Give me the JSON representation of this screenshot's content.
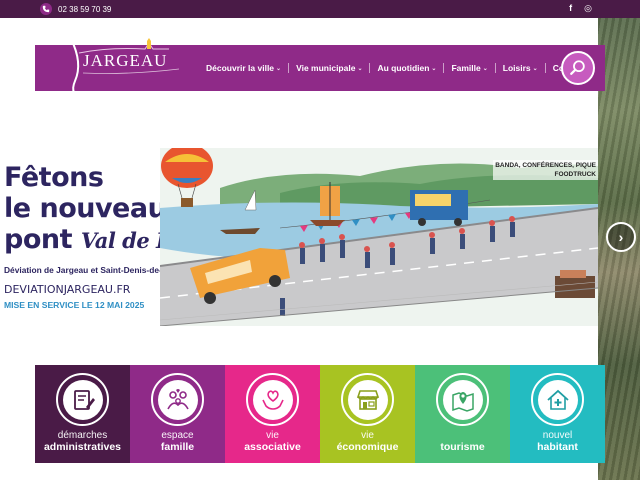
{
  "topbar": {
    "phone": "02 38 59 70 39",
    "social": [
      "f",
      "◎"
    ]
  },
  "header": {
    "logo_text": "JARGEAU",
    "nav": [
      {
        "label": "Découvrir la ville",
        "caret": "⌄"
      },
      {
        "label": "Vie municipale",
        "caret": "⌄"
      },
      {
        "label": "Au quotidien",
        "caret": "⌄"
      },
      {
        "label": "Famille",
        "caret": "⌄"
      },
      {
        "label": "Loisirs",
        "caret": "⌄"
      },
      {
        "label": "Contact",
        "caret": ""
      }
    ],
    "search_icon": "search-icon"
  },
  "hero": {
    "title_line1": "Fêtons",
    "title_line2": "le nouveau",
    "title_line3_a": "pont",
    "title_line3_b": "Val de Loire",
    "subtitle": "Déviation de Jargeau et Saint-Denis-de-l'Hôtel",
    "url": "DEVIATIONJARGEAU.FR",
    "date": "MISE EN SERVICE LE 12 MAI 2025",
    "banda_line1": "BANDA, CONFÉRENCES, PIQUE",
    "banda_line2": "FOODTRUCK"
  },
  "carousel": {
    "next": "›"
  },
  "tiles": [
    {
      "line1": "démarches",
      "line2": "administratives",
      "color": "#4a1b47",
      "icon": "document-pen-icon"
    },
    {
      "line1": "espace",
      "line2": "famille",
      "color": "#8f2a88",
      "icon": "family-icon"
    },
    {
      "line1": "vie",
      "line2": "associative",
      "color": "#e6288a",
      "icon": "heart-hands-icon"
    },
    {
      "line1": "vie",
      "line2": "économique",
      "color": "#a8c322",
      "icon": "shop-icon"
    },
    {
      "line1": "",
      "line2": "tourisme",
      "color": "#4cc079",
      "icon": "map-pin-icon"
    },
    {
      "line1": "nouvel",
      "line2": "habitant",
      "color": "#23bcc1",
      "icon": "house-plus-icon"
    }
  ],
  "colors": {
    "topbar": "#4a1b47",
    "navbar": "#8f2a88",
    "hero_text": "#2d2560",
    "hero_date": "#2f8fc4"
  }
}
